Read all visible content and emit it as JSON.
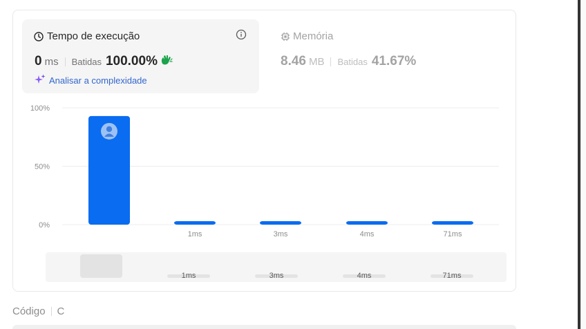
{
  "runtime": {
    "title": "Tempo de execução",
    "value": "0",
    "unit": "ms",
    "beats_label": "Batidas",
    "beats_value": "100.00%",
    "analyze_label": "Analisar a complexidade"
  },
  "memory": {
    "title": "Memória",
    "value": "8.46",
    "unit": "MB",
    "beats_label": "Batidas",
    "beats_value": "41.67%"
  },
  "chart_data": {
    "type": "bar",
    "categories": [
      "",
      "1ms",
      "3ms",
      "4ms",
      "71ms"
    ],
    "values": [
      93,
      1.5,
      1.5,
      1.5,
      1.5
    ],
    "ylim": [
      0,
      100
    ],
    "yticks": [
      "100%",
      "50%",
      "0%"
    ],
    "highlight_index": 0,
    "grid": true,
    "bar_color": "#0a6cf0"
  },
  "overview": {
    "labels": [
      "1ms",
      "3ms",
      "4ms",
      "71ms"
    ]
  },
  "footer": {
    "code_label": "Código",
    "language": "C"
  },
  "colors": {
    "accent": "#0a6cf0",
    "link": "#3366cc",
    "wave": "#1aa34a",
    "sparkle": "#8b5cf6"
  }
}
